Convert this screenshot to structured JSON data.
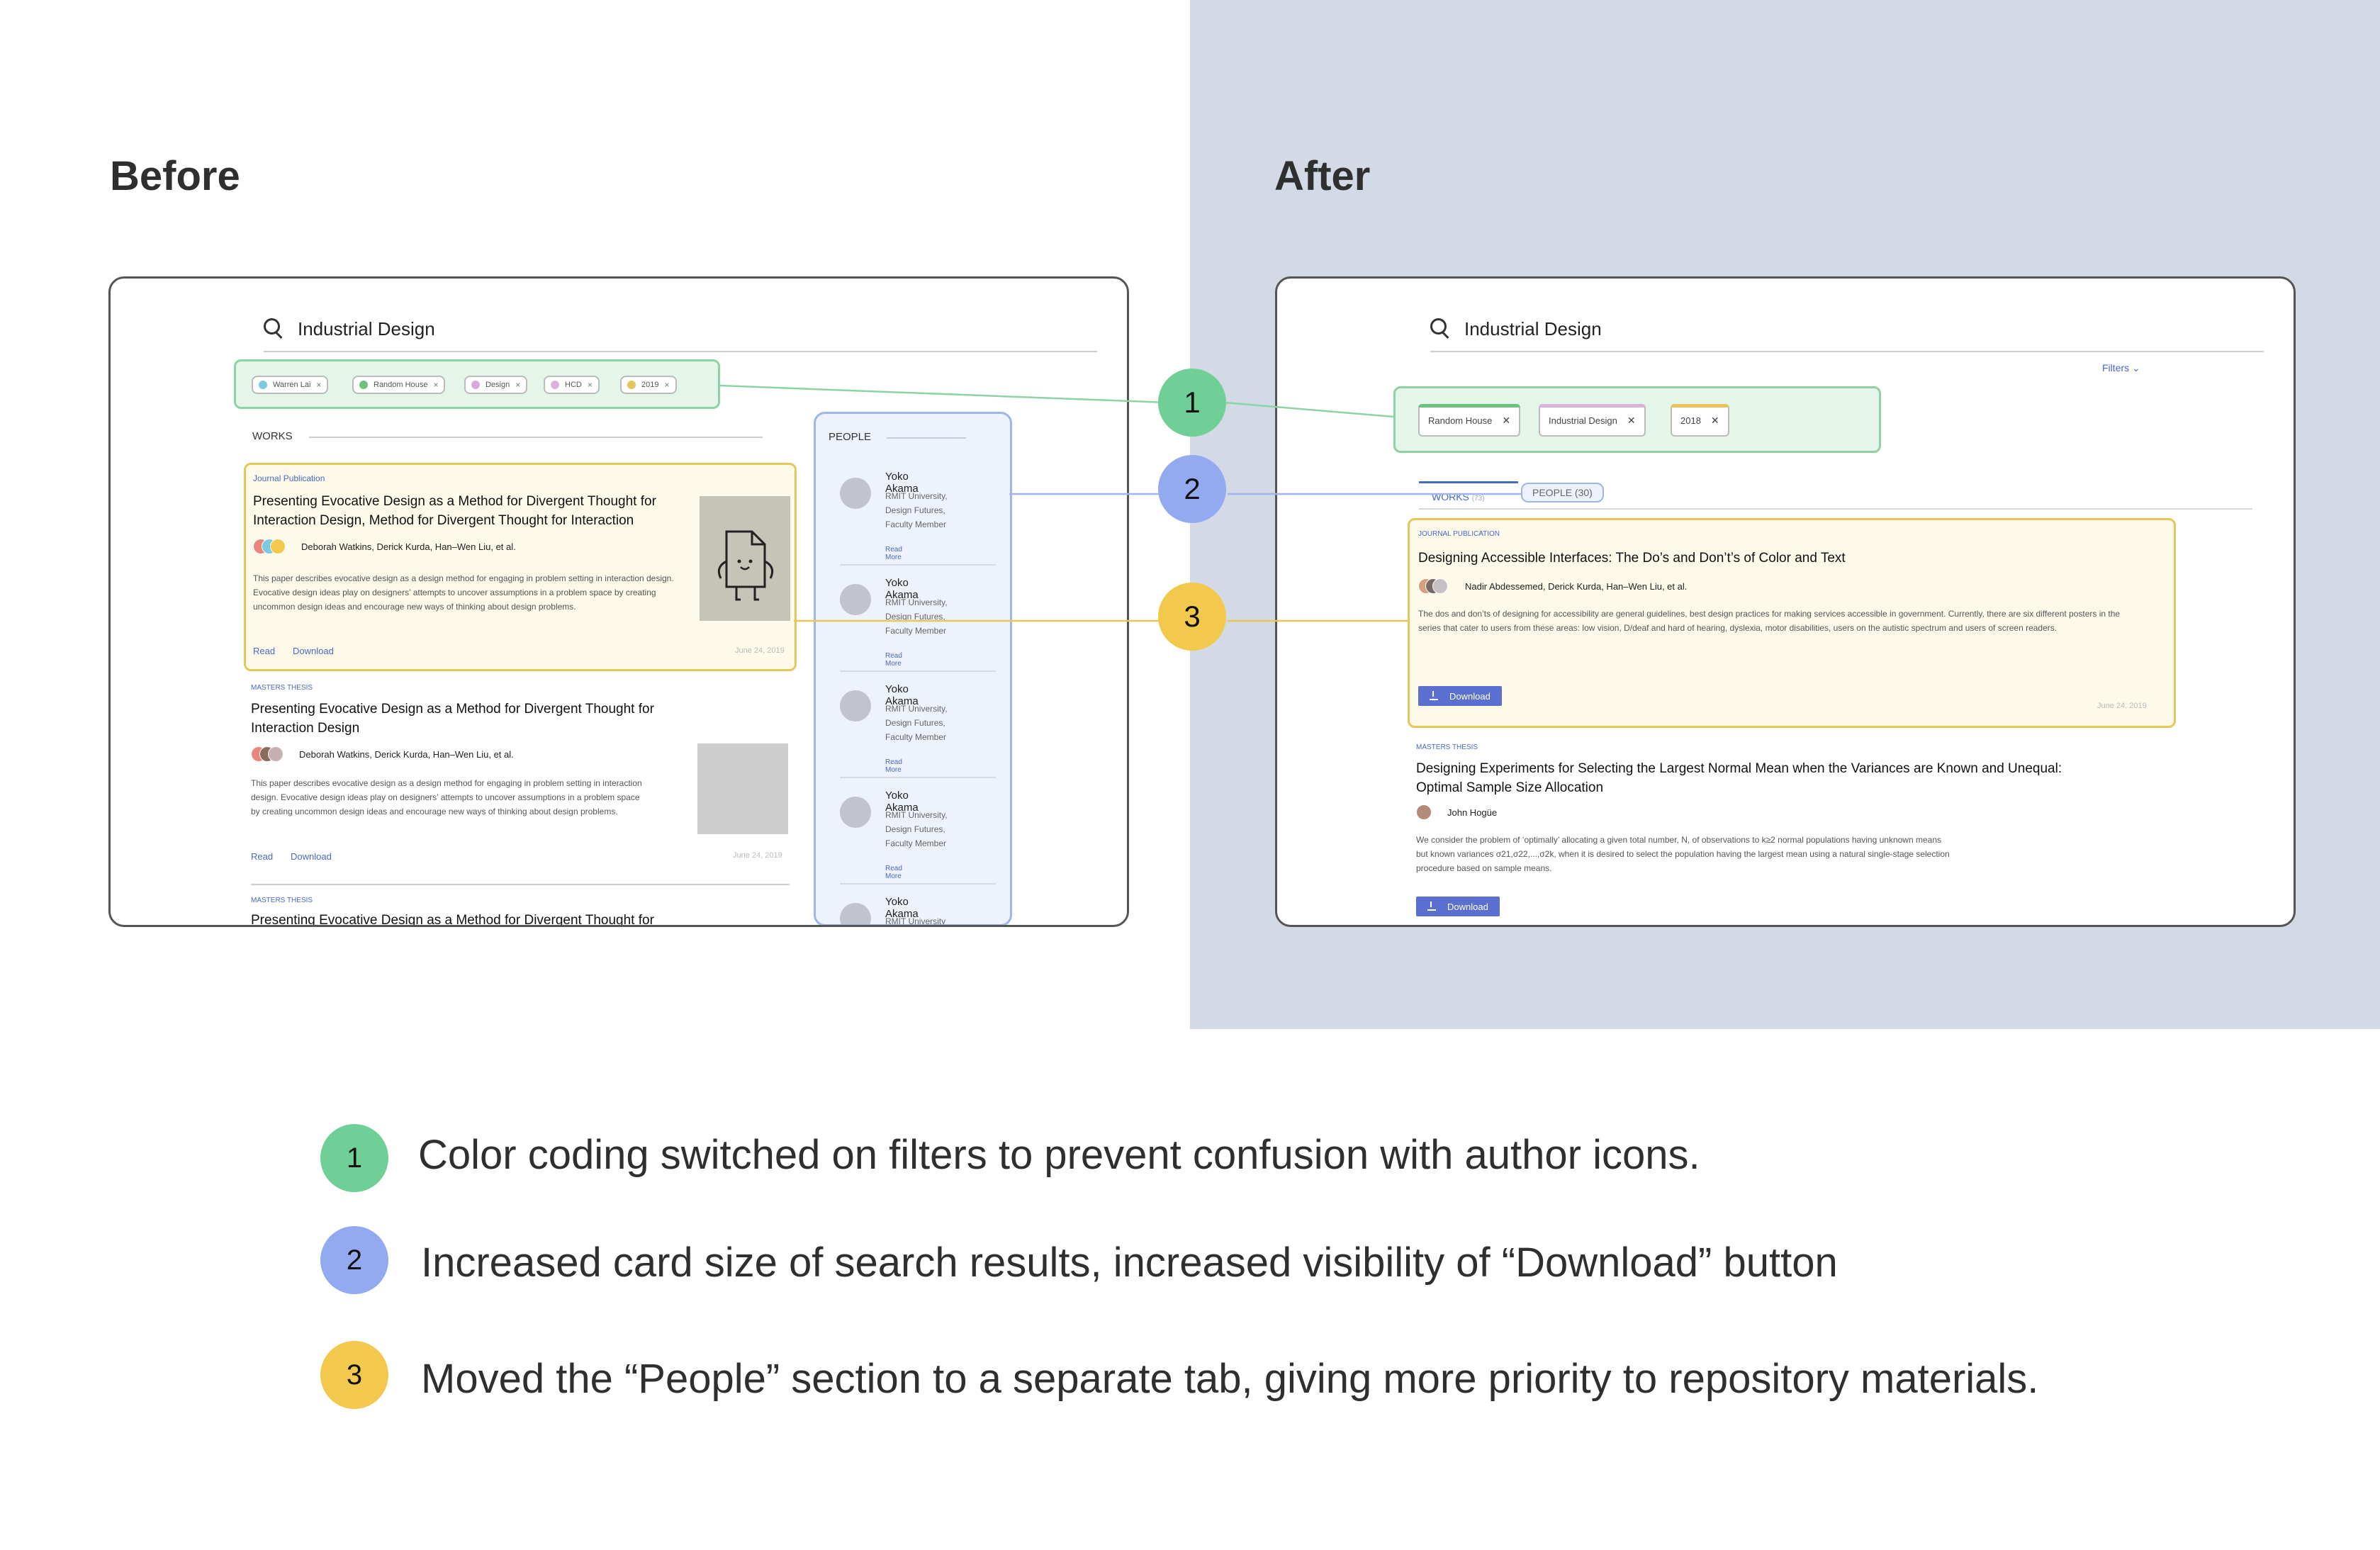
{
  "before": {
    "heading": "Before",
    "search": "Industrial Design",
    "chips": [
      {
        "label": "Warren Lai",
        "color": "#7fc9e0"
      },
      {
        "label": "Random House",
        "color": "#6cc27c"
      },
      {
        "label": "Design",
        "color": "#d9a9d9"
      },
      {
        "label": "HCD",
        "color": "#d9b3d9"
      },
      {
        "label": "2019",
        "color": "#e8c55a"
      }
    ],
    "chip_close": "×",
    "works_label": "WORKS",
    "cards": [
      {
        "kicker": "Journal Publication",
        "title": "Presenting Evocative Design as a Method for Divergent Thought for Interaction Design, Method for Divergent Thought for Interaction",
        "authors": "Deborah Watkins, Derick Kurda, Han–Wen Liu, et al.",
        "abstract": "This paper describes evocative design as a design method for engaging in problem setting in interaction design. Evocative design ideas play on designers’ attempts to uncover assumptions in a problem space by creating uncommon design ideas and encourage new ways of thinking about design problems.",
        "read": "Read",
        "download": "Download",
        "date": "June 24, 2019"
      },
      {
        "kicker": "MASTERS THESIS",
        "title": "Presenting Evocative Design as a Method for Divergent Thought for Interaction Design",
        "authors": "Deborah Watkins, Derick Kurda, Han–Wen Liu, et al.",
        "abstract": "This paper describes evocative design as a design method for engaging in problem setting in interaction design. Evocative design ideas play on designers’ attempts to uncover assumptions in a problem space by creating uncommon design ideas and encourage new ways of thinking about design problems.",
        "read": "Read",
        "download": "Download",
        "date": "June 24, 2019"
      },
      {
        "kicker": "MASTERS THESIS",
        "title": "Presenting Evocative Design as a Method for Divergent Thought for"
      }
    ],
    "people": {
      "header": "PEOPLE",
      "items": [
        {
          "name": "Yoko Akama",
          "affiliation": "RMIT University, Design Futures, Faculty Member",
          "more": "Read More"
        },
        {
          "name": "Yoko Akama",
          "affiliation": "RMIT University, Design Futures, Faculty Member",
          "more": "Read More"
        },
        {
          "name": "Yoko Akama",
          "affiliation": "RMIT University, Design Futures, Faculty Member",
          "more": "Read More"
        },
        {
          "name": "Yoko Akama",
          "affiliation": "RMIT University, Design Futures, Faculty Member",
          "more": "Read More"
        },
        {
          "name": "Yoko Akama",
          "affiliation": "RMIT University",
          "more": ""
        }
      ]
    }
  },
  "after": {
    "heading": "After",
    "search": "Industrial Design",
    "filters_link": "Filters ⌄",
    "chips": [
      {
        "label": "Random House",
        "color": "#6cc27c"
      },
      {
        "label": "Industrial Design",
        "color": "#d9b3d9"
      },
      {
        "label": "2018",
        "color": "#e8c55a"
      }
    ],
    "chip_close": "✕",
    "tabs": {
      "works": "WORKS",
      "works_count": "(73)",
      "people": "PEOPLE",
      "people_count": "(30)"
    },
    "cards": [
      {
        "kicker": "JOURNAL PUBLICATION",
        "title": "Designing Accessible Interfaces: The Do’s and Don’t’s of Color and Text",
        "authors": "Nadir Abdessemed, Derick Kurda, Han–Wen Liu, et al.",
        "abstract": "The dos and don’ts of designing for accessibility are general guidelines, best design practices for making services accessible in government. Currently, there are six different posters in the series that cater to users from these areas: low vision, D/deaf and hard of hearing, dyslexia, motor disabilities, users on the autistic spectrum and users of screen readers.",
        "download": "Download",
        "date": "June 24, 2019"
      },
      {
        "kicker": "MASTERS THESIS",
        "title": "Designing Experiments for Selecting the Largest Normal Mean when the Variances are Known and Unequal: Optimal Sample Size Allocation",
        "authors": "John Hogüe",
        "abstract": "We consider the problem of ‘optimally’ allocating a given total number, N, of observations to k≥2 normal populations having unknown means but known variances σ21,σ22,...,σ2k, when it is desired to select the population having the largest mean using a natural single-stage selection procedure based on sample means.",
        "download": "Download"
      }
    ]
  },
  "callouts": [
    {
      "num": "1",
      "color": "#6fcf97"
    },
    {
      "num": "2",
      "color": "#93aaf0"
    },
    {
      "num": "3",
      "color": "#f2c94c"
    }
  ],
  "legend": [
    {
      "num": "1",
      "text": "Color coding switched on filters to prevent confusion with author icons."
    },
    {
      "num": "2",
      "text": "Increased card size of search results, increased visibility of “Download” button"
    },
    {
      "num": "3",
      "text": "Moved the “People” section to a separate tab, giving more priority to  repository materials."
    }
  ],
  "colors": {
    "accent_blue": "#4a68c8",
    "after_panel_bg": "#d3dae5",
    "filter_highlight": "#8ed3a4",
    "card_highlight": "#e8c65a",
    "people_highlight": "#9fb5ec"
  }
}
